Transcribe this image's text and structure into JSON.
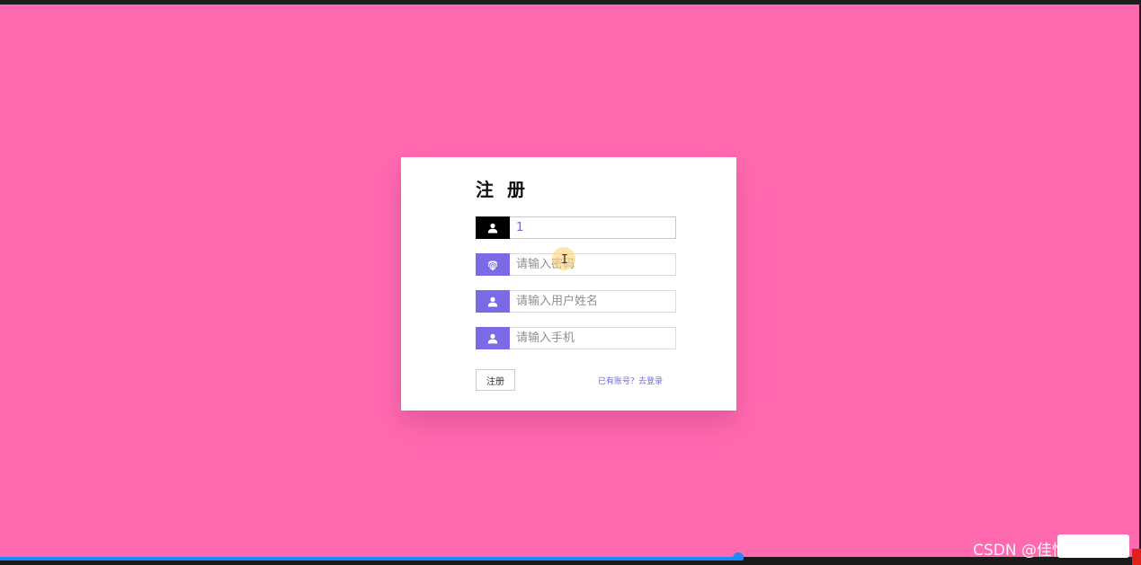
{
  "form": {
    "title": "注 册",
    "username": {
      "value": "1"
    },
    "password": {
      "placeholder": "请输入密码"
    },
    "realname": {
      "placeholder": "请输入用户姓名"
    },
    "phone": {
      "placeholder": "请输入手机"
    },
    "submit_label": "注册",
    "login_link": "已有账号？去登录"
  },
  "icons": {
    "username": "user-icon",
    "password": "fingerprint-icon",
    "realname": "user-icon",
    "phone": "user-icon"
  },
  "colors": {
    "background": "#ff69b0",
    "accent": "#7b6ae6",
    "active_icon": "#000000",
    "link": "#6d6ad8",
    "progress": "#1e88ff"
  },
  "video": {
    "progress": 0.647
  },
  "watermark": "CSDN @佳愉毕设源码"
}
